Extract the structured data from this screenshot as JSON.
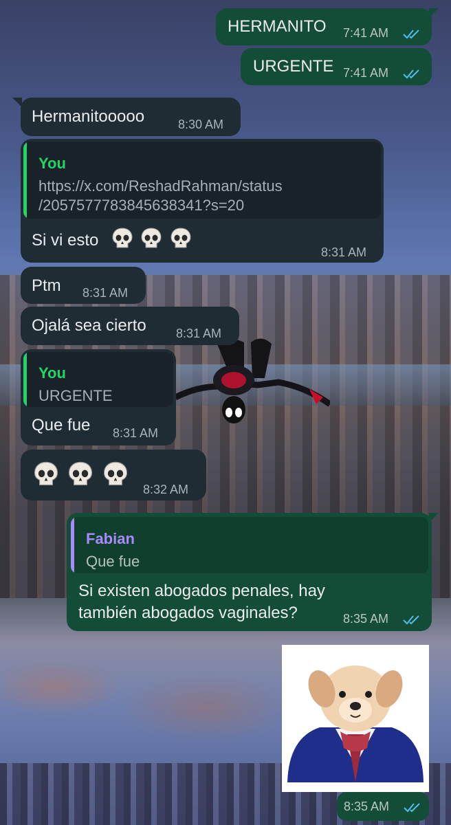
{
  "colors": {
    "outgoing": "#144d37",
    "incoming": "#1f2c34",
    "read_ticks": "#53bdeb",
    "quote_you": "#25d366",
    "quote_fabian": "#a78bfa"
  },
  "messages": {
    "m1": {
      "text": "HERMANITO",
      "time": "7:41 AM",
      "status": "read"
    },
    "m2": {
      "text": "URGENTE",
      "time": "7:41 AM",
      "status": "read"
    },
    "m3": {
      "text": "Hermanitooooo",
      "time": "8:30 AM"
    },
    "m4": {
      "quote_name": "You",
      "quote_line1": "https://x.com/ReshadRahman/status",
      "quote_line2": "/2057577783845638341?s=20",
      "text": "Si vi esto",
      "emoji": "skull-icon x3",
      "time": "8:31 AM"
    },
    "m5": {
      "text": "Ptm",
      "time": "8:31 AM"
    },
    "m6": {
      "text": "Ojalá sea cierto",
      "time": "8:31 AM"
    },
    "m7": {
      "quote_name": "You",
      "quote_text": "URGENTE",
      "text": "Que fue",
      "time": "8:31 AM"
    },
    "m8": {
      "emoji": "skull-icon x3",
      "time": "8:32 AM"
    },
    "m9": {
      "quote_name": "Fabian",
      "quote_text": "Que fue",
      "line1": "Si existen abogados penales, hay",
      "line2": "también abogados vaginales?",
      "time": "8:35 AM",
      "status": "read"
    },
    "m10": {
      "sticker": "dog-in-suit-sticker",
      "time": "8:35 AM",
      "status": "read"
    }
  }
}
